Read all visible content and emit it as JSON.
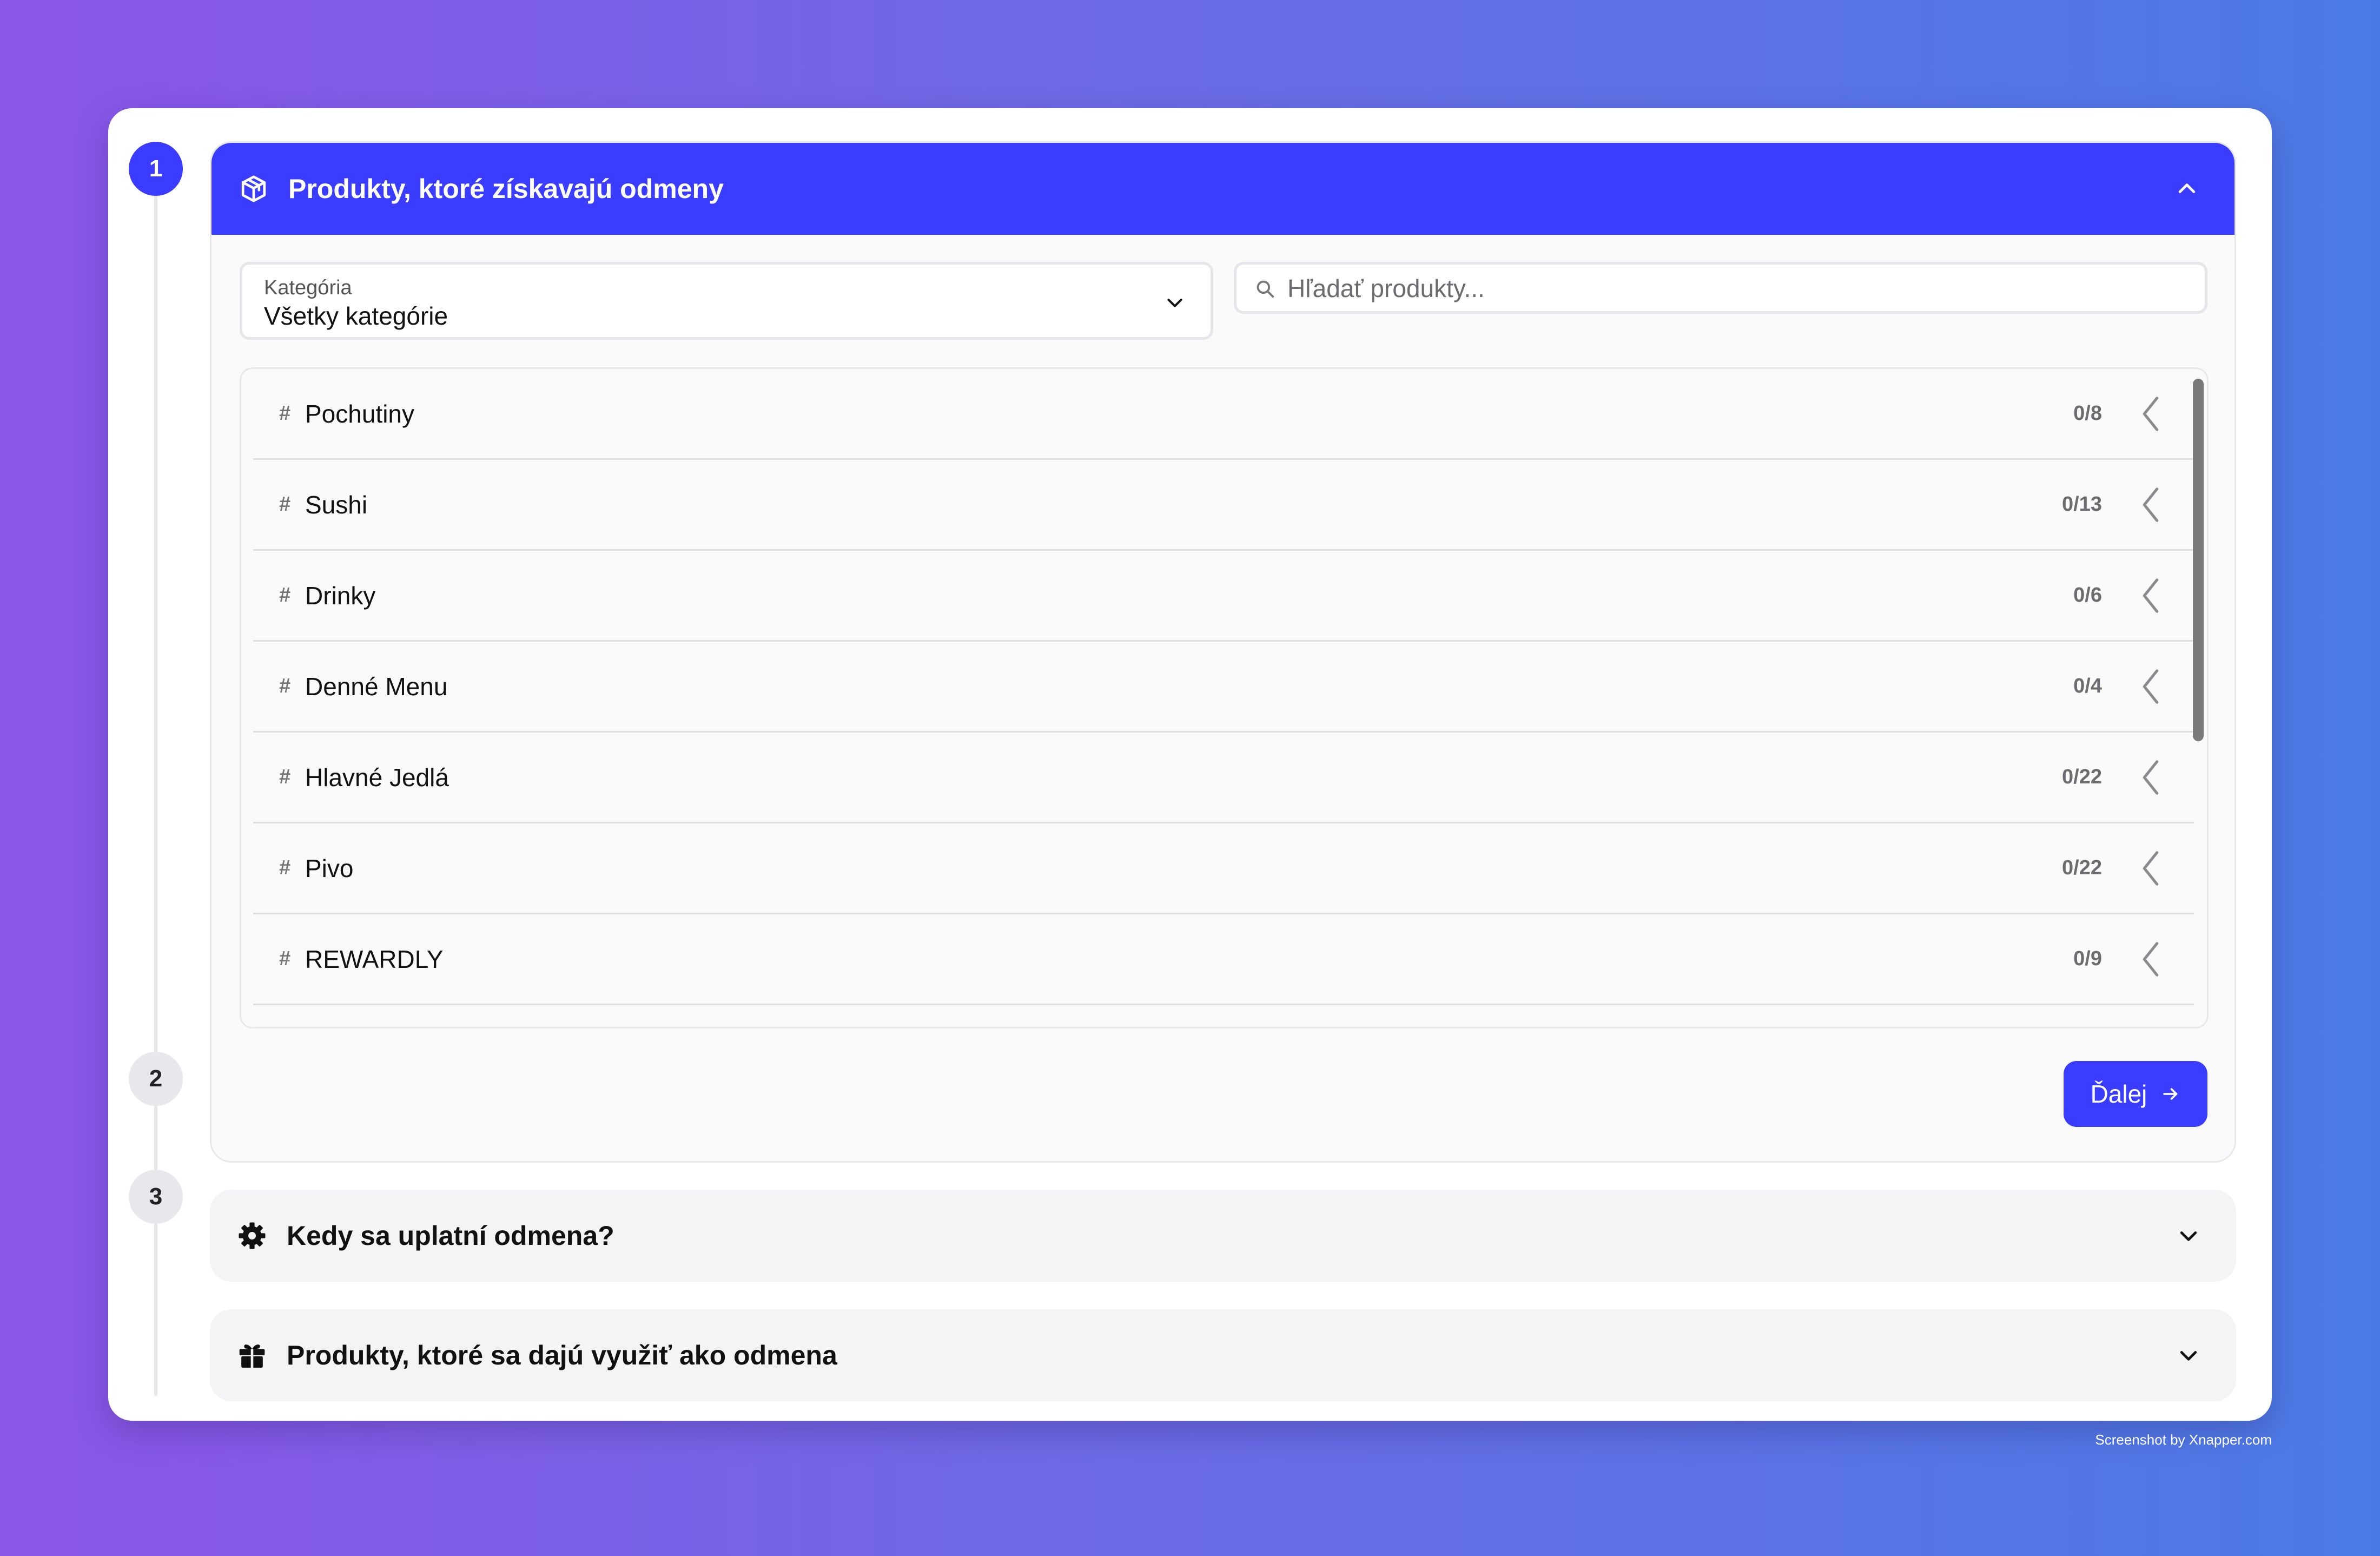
{
  "steps": {
    "step1_number": "1",
    "step2_number": "2",
    "step3_number": "3"
  },
  "section1": {
    "title": "Produkty, ktoré získavajú odmeny",
    "icon": "box-icon",
    "expanded": true,
    "category_select": {
      "label": "Kategória",
      "value": "Všetky kategórie"
    },
    "search": {
      "placeholder": "Hľadať produkty...",
      "value": ""
    },
    "categories": [
      {
        "hash": "#",
        "name": "Pochutiny",
        "count": "0/8"
      },
      {
        "hash": "#",
        "name": "Sushi",
        "count": "0/13"
      },
      {
        "hash": "#",
        "name": "Drinky",
        "count": "0/6"
      },
      {
        "hash": "#",
        "name": "Denné Menu",
        "count": "0/4"
      },
      {
        "hash": "#",
        "name": "Hlavné Jedlá",
        "count": "0/22"
      },
      {
        "hash": "#",
        "name": "Pivo",
        "count": "0/22"
      },
      {
        "hash": "#",
        "name": "REWARDLY",
        "count": "0/9"
      }
    ],
    "next_button": "Ďalej"
  },
  "section2": {
    "title": "Kedy sa uplatní odmena?",
    "icon": "gear-icon"
  },
  "section3": {
    "title": "Produkty, ktoré sa dajú využiť ako odmena",
    "icon": "gift-icon"
  },
  "watermark": "Screenshot by Xnapper.com",
  "colors": {
    "accent": "#3a3cff",
    "card_bg": "#ffffff",
    "panel_bg": "#fafafa",
    "collapsed_bg": "#f4f4f6",
    "step_inactive": "#e7e7ec"
  }
}
